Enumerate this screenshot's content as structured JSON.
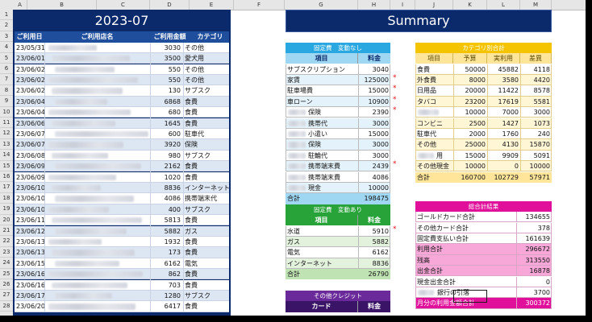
{
  "sheet": {
    "columns": [
      "A",
      "B",
      "C",
      "D",
      "E",
      "F",
      "G",
      "H",
      "I",
      "J",
      "K",
      "L",
      "M"
    ],
    "rows": [
      "1",
      "2",
      "3",
      "4",
      "5",
      "6",
      "7",
      "8",
      "9",
      "10",
      "11",
      "12",
      "13",
      "14",
      "15",
      "16",
      "17",
      "18",
      "19",
      "20",
      "21",
      "22",
      "23",
      "24",
      "25",
      "26",
      "27",
      "28"
    ]
  },
  "ledger": {
    "title": "2023-07",
    "headers": [
      "ご利用日",
      "ご利用店名",
      "ご利用金額",
      "カテゴリ"
    ],
    "rows": [
      {
        "date": "23/05/31",
        "shop_visible": "",
        "amount": "3030",
        "category": "その他"
      },
      {
        "date": "23/06/01",
        "shop_visible": "",
        "amount": "3500",
        "category": "愛犬用"
      },
      {
        "date": "23/06/02",
        "shop_visible": "",
        "amount": "550",
        "category": "その他"
      },
      {
        "date": "23/06/02",
        "shop_visible": "",
        "amount": "550",
        "category": "その他"
      },
      {
        "date": "23/06/02",
        "shop_visible": "",
        "amount": "130",
        "category": "サブスク"
      },
      {
        "date": "23/06/04",
        "shop_visible": "",
        "amount": "6868",
        "category": "食費"
      },
      {
        "date": "23/06/04",
        "shop_visible": "",
        "amount": "680",
        "category": "食費"
      },
      {
        "date": "23/06/06",
        "shop_visible": "",
        "amount": "1645",
        "category": "食費"
      },
      {
        "date": "23/06/07",
        "shop_visible": "",
        "amount": "600",
        "category": "駐車代"
      },
      {
        "date": "23/06/07",
        "shop_visible": "",
        "amount": "3920",
        "category": "保険"
      },
      {
        "date": "23/06/08",
        "shop_visible": "",
        "amount": "980",
        "category": "サブスク"
      },
      {
        "date": "23/06/09",
        "shop_visible": "",
        "amount": "2162",
        "category": "食費"
      },
      {
        "date": "23/06/09",
        "shop_visible": "",
        "amount": "1020",
        "category": "食費"
      },
      {
        "date": "23/06/10",
        "shop_visible": "",
        "amount": "8836",
        "category": "インターネット"
      },
      {
        "date": "23/06/10",
        "shop_visible": "",
        "amount": "4086",
        "category": "携帯端末代"
      },
      {
        "date": "23/06/10",
        "shop_visible": "",
        "amount": "400",
        "category": "サブスク"
      },
      {
        "date": "23/06/11",
        "shop_visible": "",
        "amount": "5813",
        "category": "食費"
      },
      {
        "date": "23/06/12",
        "shop_visible": "",
        "amount": "5882",
        "category": "ガス"
      },
      {
        "date": "23/06/13",
        "shop_visible": "",
        "amount": "1932",
        "category": "食費"
      },
      {
        "date": "23/06/13",
        "shop_visible": "",
        "amount": "173",
        "category": "食費"
      },
      {
        "date": "23/06/15",
        "shop_visible": "",
        "amount": "6162",
        "category": "電気"
      },
      {
        "date": "23/06/16",
        "shop_visible": "",
        "amount": "862",
        "category": "食費"
      },
      {
        "date": "23/06/16",
        "shop_visible": "",
        "amount": "703",
        "category": "食費"
      },
      {
        "date": "23/06/17",
        "shop_visible": "",
        "amount": "1280",
        "category": "サブスク"
      },
      {
        "date": "23/06/20",
        "shop_visible": "",
        "amount": "6417",
        "category": "食費"
      }
    ]
  },
  "summary": {
    "title": "Summary",
    "fixed": {
      "title": "固定費　変動なし",
      "headers": [
        "項目",
        "料金"
      ],
      "rows": [
        {
          "label": "サブスクリプション",
          "value": "3040",
          "mark": ""
        },
        {
          "label": "家賃",
          "value": "125000",
          "mark": "*"
        },
        {
          "label": "駐車場費",
          "value": "15000",
          "mark": "*"
        },
        {
          "label": "車ローン",
          "value": "10900",
          "mark": "*"
        },
        {
          "label": "保険",
          "value": "2390",
          "mark": "*"
        },
        {
          "label": "携帯代",
          "value": "3000",
          "mark": ""
        },
        {
          "label": "小遣い",
          "value": "15000",
          "mark": ""
        },
        {
          "label": "保険",
          "value": "3000",
          "mark": ""
        },
        {
          "label": "駐輪代",
          "value": "3000",
          "mark": ""
        },
        {
          "label": "携帯端末費",
          "value": "2439",
          "mark": "*"
        },
        {
          "label": "携帯端末費",
          "value": "4086",
          "mark": ""
        },
        {
          "label": "現金",
          "value": "10000",
          "mark": ""
        }
      ],
      "total_label": "合計",
      "total_value": "198475"
    },
    "variable": {
      "title": "固定費　変動あり",
      "headers": [
        "項目",
        "料金"
      ],
      "rows": [
        {
          "label": "水道",
          "value": "5910",
          "mark": "*"
        },
        {
          "label": "ガス",
          "value": "5882",
          "mark": ""
        },
        {
          "label": "電気",
          "value": "6162",
          "mark": ""
        },
        {
          "label": "インターネット",
          "value": "8836",
          "mark": ""
        }
      ],
      "total_label": "合計",
      "total_value": "26790"
    },
    "other_credit": {
      "title": "その他クレジット",
      "headers": [
        "カード",
        "料金"
      ]
    },
    "category": {
      "title": "カテゴリ別合計",
      "headers": [
        "項目",
        "予算",
        "実利用",
        "差異"
      ],
      "rows": [
        {
          "label": "食費",
          "budget": "50000",
          "actual": "45882",
          "diff": "4118"
        },
        {
          "label": "外食費",
          "budget": "8000",
          "actual": "3580",
          "diff": "4420"
        },
        {
          "label": "日用品",
          "budget": "20000",
          "actual": "11422",
          "diff": "8578"
        },
        {
          "label": "タバコ",
          "budget": "23200",
          "actual": "17619",
          "diff": "5581"
        },
        {
          "label": "",
          "budget": "10000",
          "actual": "7000",
          "diff": "3000"
        },
        {
          "label": "コンビニ",
          "budget": "2500",
          "actual": "1427",
          "diff": "1073"
        },
        {
          "label": "駐車代",
          "budget": "2000",
          "actual": "1760",
          "diff": "240"
        },
        {
          "label": "その他",
          "budget": "25000",
          "actual": "4130",
          "diff": "15870"
        },
        {
          "label": "用",
          "budget": "15000",
          "actual": "9909",
          "diff": "5091"
        },
        {
          "label": "その他現金",
          "budget": "10000",
          "actual": "0",
          "diff": "10000"
        }
      ],
      "total_label": "合計",
      "total_budget": "160700",
      "total_actual": "102729",
      "total_diff": "57971"
    },
    "result": {
      "title": "総合計結果",
      "rows": [
        {
          "label": "ゴールドカード合計",
          "value": "134655",
          "style": "plain"
        },
        {
          "label": "その他カード合計",
          "value": "378",
          "style": "plain"
        },
        {
          "label": "固定費支払い合計",
          "value": "161639",
          "style": "plain"
        },
        {
          "label": "利用合計",
          "value": "296672",
          "style": "pink"
        },
        {
          "label": "残高",
          "value": "313550",
          "style": "pink"
        },
        {
          "label": "出金合計",
          "value": "16878",
          "style": "pink"
        },
        {
          "label": "現金出金合計",
          "value": "0",
          "style": "plain"
        },
        {
          "label": "銀行の引落",
          "value": "3700",
          "style": "plain"
        },
        {
          "label": "月分の利用金額合計",
          "value": "300372",
          "style": "magenta"
        }
      ]
    }
  },
  "colors": {
    "dark_navy": "#0b2a6b",
    "ledger_header": "#1f4e9c",
    "sky": "#29a7e0",
    "green": "#27a33a",
    "purple": "#6a2a9a",
    "gold": "#f5c400",
    "magenta": "#e0109a"
  }
}
